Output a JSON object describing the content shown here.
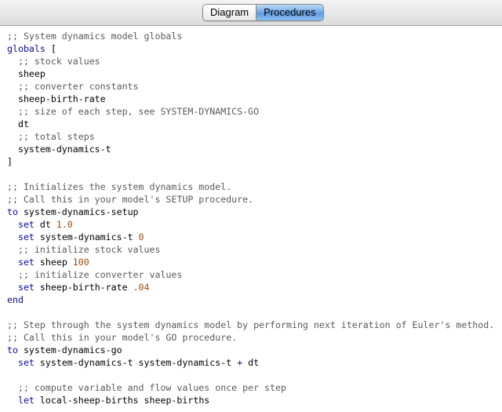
{
  "tabs": [
    {
      "label": "Diagram",
      "active": false
    },
    {
      "label": "Procedures",
      "active": true
    }
  ],
  "colors": {
    "comment": "#5a5a5a",
    "keyword": "#0a0aa0",
    "number": "#9c4a10",
    "plain": "#000000",
    "active_tab": "#6fa8e6"
  },
  "code_lines": [
    [
      {
        "t": ";; System dynamics model globals",
        "c": "cm"
      }
    ],
    [
      {
        "t": "globals",
        "c": "kw"
      },
      {
        "t": " [",
        "c": "pl"
      }
    ],
    [
      {
        "t": "  ;; stock values",
        "c": "cm"
      }
    ],
    [
      {
        "t": "  sheep",
        "c": "pl"
      }
    ],
    [
      {
        "t": "  ;; converter constants",
        "c": "cm"
      }
    ],
    [
      {
        "t": "  sheep-birth-rate",
        "c": "pl"
      }
    ],
    [
      {
        "t": "  ;; size of each step, see SYSTEM-DYNAMICS-GO",
        "c": "cm"
      }
    ],
    [
      {
        "t": "  dt",
        "c": "pl"
      }
    ],
    [
      {
        "t": "  ;; total steps",
        "c": "cm"
      }
    ],
    [
      {
        "t": "  system-dynamics-t",
        "c": "pl"
      }
    ],
    [
      {
        "t": "]",
        "c": "pl"
      }
    ],
    [],
    [
      {
        "t": ";; Initializes the system dynamics model.",
        "c": "cm"
      }
    ],
    [
      {
        "t": ";; Call this in your model's SETUP procedure.",
        "c": "cm"
      }
    ],
    [
      {
        "t": "to",
        "c": "kw"
      },
      {
        "t": " system-dynamics-setup",
        "c": "pl"
      }
    ],
    [
      {
        "t": "  ",
        "c": "pl"
      },
      {
        "t": "set",
        "c": "kw"
      },
      {
        "t": " dt ",
        "c": "pl"
      },
      {
        "t": "1.0",
        "c": "num"
      }
    ],
    [
      {
        "t": "  ",
        "c": "pl"
      },
      {
        "t": "set",
        "c": "kw"
      },
      {
        "t": " system-dynamics-t ",
        "c": "pl"
      },
      {
        "t": "0",
        "c": "num"
      }
    ],
    [
      {
        "t": "  ;; initialize stock values",
        "c": "cm"
      }
    ],
    [
      {
        "t": "  ",
        "c": "pl"
      },
      {
        "t": "set",
        "c": "kw"
      },
      {
        "t": " sheep ",
        "c": "pl"
      },
      {
        "t": "100",
        "c": "num"
      }
    ],
    [
      {
        "t": "  ;; initialize converter values",
        "c": "cm"
      }
    ],
    [
      {
        "t": "  ",
        "c": "pl"
      },
      {
        "t": "set",
        "c": "kw"
      },
      {
        "t": " sheep-birth-rate ",
        "c": "pl"
      },
      {
        "t": ".04",
        "c": "num"
      }
    ],
    [
      {
        "t": "end",
        "c": "kw"
      }
    ],
    [],
    [
      {
        "t": ";; Step through the system dynamics model by performing next iteration of Euler's method.",
        "c": "cm"
      }
    ],
    [
      {
        "t": ";; Call this in your model's GO procedure.",
        "c": "cm"
      }
    ],
    [
      {
        "t": "to",
        "c": "kw"
      },
      {
        "t": " system-dynamics-go",
        "c": "pl"
      }
    ],
    [
      {
        "t": "  ",
        "c": "pl"
      },
      {
        "t": "set",
        "c": "kw"
      },
      {
        "t": " system-dynamics-t system-dynamics-t ",
        "c": "pl"
      },
      {
        "t": "+",
        "c": "kw"
      },
      {
        "t": " dt",
        "c": "pl"
      }
    ],
    [],
    [
      {
        "t": "  ;; compute variable and flow values once per step",
        "c": "cm"
      }
    ],
    [
      {
        "t": "  ",
        "c": "pl"
      },
      {
        "t": "let",
        "c": "kw"
      },
      {
        "t": " local-sheep-births sheep-births",
        "c": "pl"
      }
    ]
  ]
}
